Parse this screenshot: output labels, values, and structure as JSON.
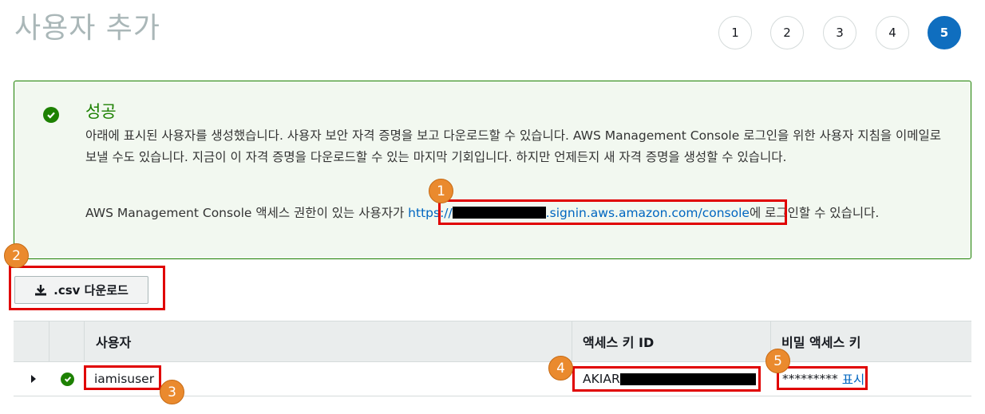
{
  "page": {
    "title": "사용자 추가"
  },
  "steps": [
    "1",
    "2",
    "3",
    "4",
    "5"
  ],
  "active_step": "5",
  "success": {
    "title": "성공",
    "message": "아래에 표시된 사용자를 생성했습니다. 사용자 보안 자격 증명을 보고 다운로드할 수 있습니다. AWS Management Console 로그인을 위한 사용자 지침을 이메일로 보낼 수도 있습니다. 지금이 이 자격 증명을 다운로드할 수 있는 마지막 기회입니다. 하지만 언제든지 새 자격 증명을 생성할 수 있습니다.",
    "console_prefix": "AWS Management Console 액세스 권한이 있는 사용자가 ",
    "console_link_start": "https://",
    "console_link_end": ".signin.aws.amazon.com/console",
    "console_suffix": "에 로그인할 수 있습니다."
  },
  "download_button": {
    "label": ".csv 다운로드",
    "icon": "download-icon"
  },
  "table": {
    "headers": {
      "user": "사용자",
      "access_key": "액세스 키 ID",
      "secret_key": "비밀 액세스 키"
    },
    "rows": [
      {
        "user": "iamisuser",
        "access_key_prefix": "AKIAR",
        "secret_masked": "*********",
        "show_label": "표시",
        "status": "success"
      }
    ]
  },
  "annotations": [
    "1",
    "2",
    "3",
    "4",
    "5"
  ],
  "colors": {
    "success": "#1d8102",
    "link": "#0066c0",
    "highlight": "#e00000",
    "badge": "#ea8a2e",
    "step_active": "#0f6ebf"
  }
}
